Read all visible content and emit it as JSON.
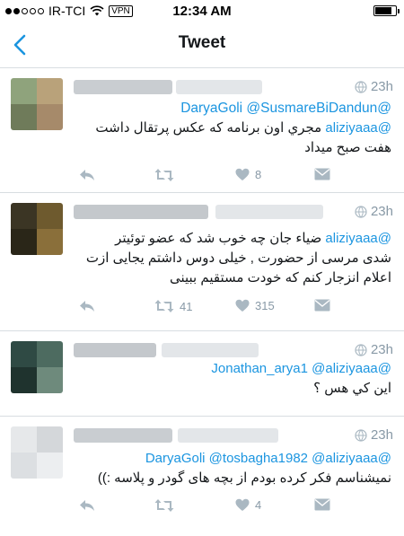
{
  "status_bar": {
    "carrier": "IR-TCI",
    "vpn_label": "VPN",
    "time": "12:34 AM",
    "battery_level": 0.8
  },
  "nav": {
    "title": "Tweet",
    "back_icon": "chevron-left-icon"
  },
  "colors": {
    "link": "#1b95e0",
    "muted": "#8899a6",
    "divider": "#d8dde1"
  },
  "tweets": [
    {
      "time": "23h",
      "mention_line_1": "@DaryaGoli @SusmareBiDandun",
      "mention_line_2": "@aliziyaaa",
      "text_1": "مجري اون برنامه که عکس پرتقال داشت",
      "text_2": "هفت صبح ميداد",
      "reply_count": "",
      "retweet_count": "",
      "like_count": "8"
    },
    {
      "time": "23h",
      "mention_line_1": "@aliziyaaa",
      "text_1": "ضیاء جان چه خوب شد که عضو توئیتر",
      "text_2": "شدی مرسی از حضورت , خیلی دوس داشتم یجایی ازت",
      "text_3": "اعلام انزجار کنم که خودت مستقیم ببینی",
      "reply_count": "",
      "retweet_count": "41",
      "like_count": "315"
    },
    {
      "time": "23h",
      "mention_line_1": "@Jonathan_arya1 @aliziyaaa",
      "text_1": "اين کي هس ؟",
      "reply_count": "",
      "retweet_count": "",
      "like_count": ""
    },
    {
      "time": "23h",
      "mention_line_1": "@DaryaGoli @tosbagha1982 @aliziyaaa",
      "text_1": "نمیشناسم فکر کرده بودم از بچه های گودر و پلاسه :))",
      "reply_count": "",
      "retweet_count": "",
      "like_count": "4"
    }
  ]
}
